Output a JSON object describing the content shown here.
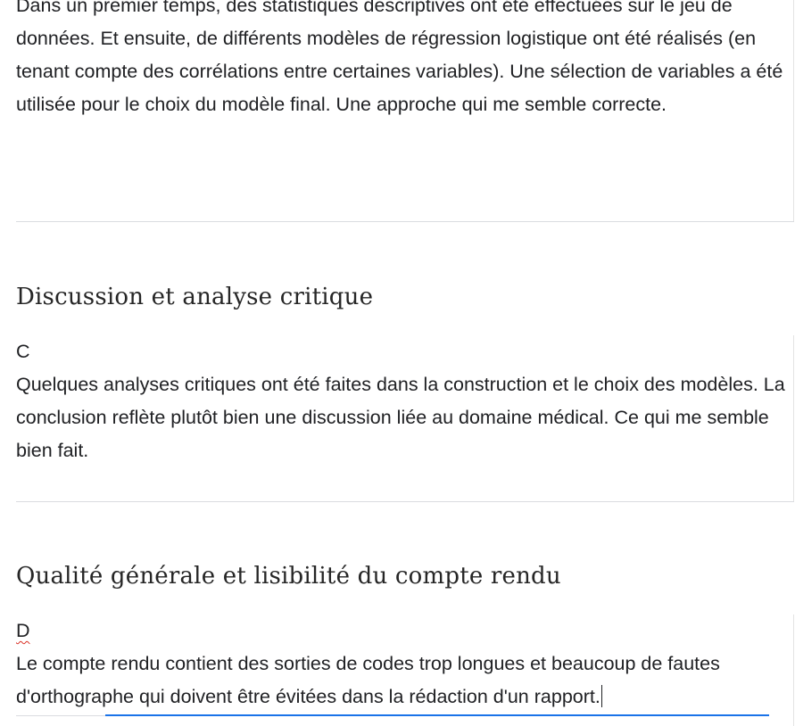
{
  "section1": {
    "answer": "Dans un premier temps, des statistiques descriptives ont été effectuées sur le jeu de données. Et ensuite, de différents modèles de régression logistique ont été réalisés (en tenant compte des corrélations entre certaines variables). Une sélection de variables a été utilisée pour le choix du modèle final. Une approche qui me semble correcte."
  },
  "section2": {
    "title": "Discussion et analyse critique",
    "grade": "C",
    "answer": "Quelques analyses critiques ont été faites dans la construction et le choix des modèles. La conclusion reflète plutôt bien une discussion liée au domaine médical. Ce qui me semble bien fait."
  },
  "section3": {
    "title": "Qualité générale et lisibilité du compte rendu",
    "grade": "D",
    "answer": "Le compte rendu contient  des sorties de codes trop longues et beaucoup de fautes d'orthographe qui doivent être évitées dans la rédaction d'un rapport."
  },
  "colors": {
    "focus_underline": "#1a73e8",
    "spellcheck": "#d93025"
  }
}
